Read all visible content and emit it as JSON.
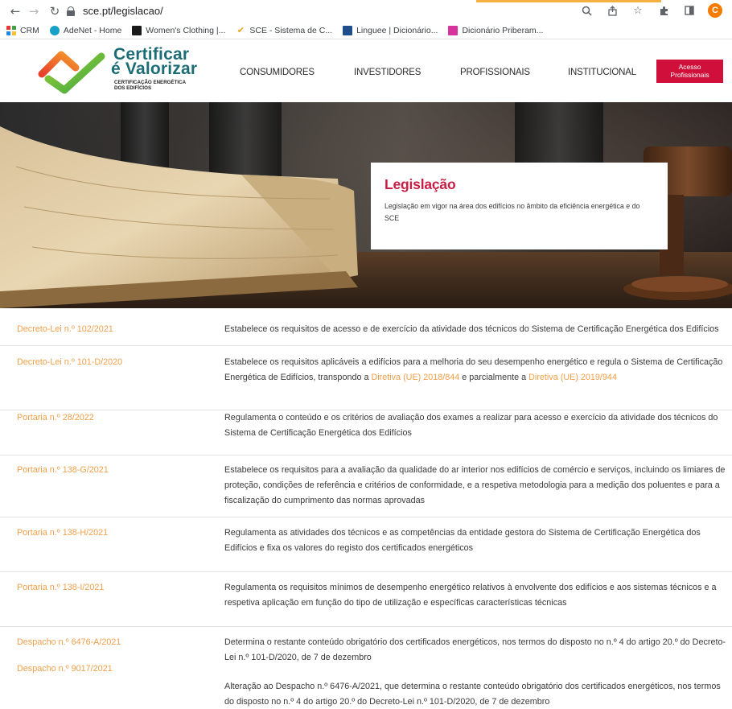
{
  "browser": {
    "url": "sce.pt/legislacao/",
    "bookmarks": [
      {
        "label": "CRM",
        "icon": "grid-icon"
      },
      {
        "label": "AdeNet - Home",
        "icon": "adenet-icon"
      },
      {
        "label": "Women's Clothing |...",
        "icon": "wc-icon"
      },
      {
        "label": "SCE - Sistema de C...",
        "icon": "sce-icon"
      },
      {
        "label": "Linguee | Dicionário...",
        "icon": "linguee-icon"
      },
      {
        "label": "Dicionário Priberam...",
        "icon": "priberam-icon"
      }
    ],
    "profile_initial": "C"
  },
  "header": {
    "logo": {
      "line1": "Certificar",
      "line2": "é Valorizar",
      "sub1": "CERTIFICAÇÃO ENERGÉTICA",
      "sub2": "DOS EDIFÍCIOS"
    },
    "nav": [
      "CONSUMIDORES",
      "INVESTIDORES",
      "PROFISSIONAIS",
      "INSTITUCIONAL"
    ],
    "cta_line1": "Acesso",
    "cta_line2": "Profissionais"
  },
  "hero": {
    "title": "Legislação",
    "description": "Legislação em vigor na área dos edifícios no âmbito da eficiência energética e do SCE"
  },
  "legislation": [
    {
      "links": [
        "Decreto-Lei n.º 102/2021"
      ],
      "paragraphs": [
        [
          {
            "t": "Estabelece os requisitos de acesso e de exercício da atividade dos técnicos do Sistema de Certificação Energética dos Edifícios"
          }
        ]
      ]
    },
    {
      "links": [
        "Decreto-Lei n.º 101-D/2020"
      ],
      "paragraphs": [
        [
          {
            "t": "Estabelece os requisitos aplicáveis a edifícios para a melhoria do seu desempenho energético e regula o Sistema de Certificação Energética de Edifícios, transpondo a "
          },
          {
            "t": "Diretiva (UE) 2018/844",
            "link": true
          },
          {
            "t": " e parcialmente a "
          },
          {
            "t": "Diretiva (UE) 2019/944",
            "link": true
          }
        ]
      ]
    },
    {
      "links": [
        "Portaria n.º 28/2022"
      ],
      "paragraphs": [
        [
          {
            "t": "Regulamenta o conteúdo e os critérios de avaliação dos exames a realizar para acesso e exercício da atividade dos técnicos do Sistema de Certificação Energética dos Edifícios"
          }
        ]
      ]
    },
    {
      "links": [
        "Portaria n.º 138-G/2021"
      ],
      "paragraphs": [
        [
          {
            "t": "Estabelece os requisitos para a avaliação da qualidade do ar interior nos edifícios de comércio e serviços, incluindo os limiares de proteção, condições de referência e critérios de conformidade, e a respetiva metodologia para a medição dos poluentes e para a fiscalização do cumprimento das normas aprovadas"
          }
        ]
      ]
    },
    {
      "links": [
        "Portaria n.º 138-H/2021"
      ],
      "paragraphs": [
        [
          {
            "t": "Regulamenta as atividades dos técnicos e as competências da entidade gestora do Sistema de Certificação Energética dos Edifícios e fixa os valores do registo dos certificados energéticos"
          }
        ]
      ]
    },
    {
      "links": [
        "Portaria n.º 138-I/2021"
      ],
      "paragraphs": [
        [
          {
            "t": "Regulamenta os requisitos mínimos de desempenho energético relativos à envolvente dos edifícios e aos sistemas técnicos e a respetiva aplicação em função do tipo de utilização e específicas características técnicas"
          }
        ]
      ]
    },
    {
      "links": [
        "Despacho n.º 6476-A/2021",
        "Despacho n.º 9017/2021"
      ],
      "paragraphs": [
        [
          {
            "t": "Determina o restante conteúdo obrigatório dos certificados energéticos, nos termos do disposto no n.º 4 do artigo 20.º do Decreto-Lei n.º 101-D/2020, de 7 de dezembro"
          }
        ],
        [
          {
            "t": "Alteração ao Despacho n.º 6476-A/2021, que determina o restante conteúdo obrigatório dos certificados energéticos, nos termos do disposto no n.º 4 do artigo 20.º do Decreto-Lei n.º 101-D/2020, de 7 de dezembro"
          }
        ]
      ]
    }
  ]
}
